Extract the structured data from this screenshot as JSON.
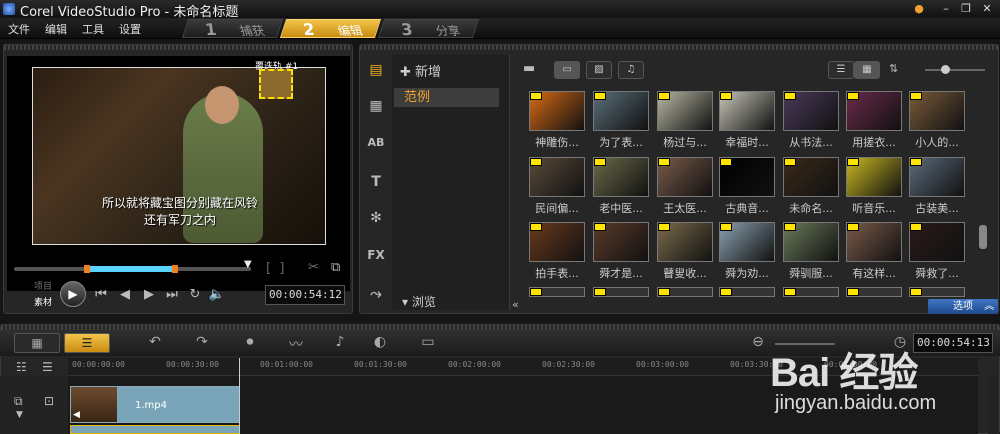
{
  "window": {
    "title": "Corel VideoStudio Pro - 未命名标题"
  },
  "menu": [
    "文件",
    "编辑",
    "工具",
    "设置"
  ],
  "steps": [
    {
      "num": "1",
      "label": "捕获"
    },
    {
      "num": "2",
      "label": "编辑"
    },
    {
      "num": "3",
      "label": "分享"
    }
  ],
  "preview": {
    "overlay_track_label": "覆迭轨 #1",
    "subtitle_line1": "所以就将藏宝图分别藏在风铃",
    "subtitle_line2": "还有军刀之内",
    "project_label": "项目",
    "clip_label": "素材",
    "timecode": "00:00:54:12",
    "scrub_selection_start": 0.31,
    "scrub_selection_end": 0.68
  },
  "library": {
    "add_label": "新增",
    "selected_folder": "范例",
    "browse_label": "浏览",
    "options_label": "选项",
    "thumbs": [
      [
        "神雕伤...",
        "为了表...",
        "杨过与...",
        "幸福时...",
        "从书法...",
        "用搓衣...",
        "小人的..."
      ],
      [
        "民间偏...",
        "老中医...",
        "王太医...",
        "古典音...",
        "未命名...",
        "听音乐...",
        "古装美..."
      ],
      [
        "拍手表...",
        "舜才是...",
        "瞽叟收...",
        "舜为劝...",
        "舜驯服...",
        "有这样...",
        "舜救了..."
      ]
    ],
    "thumb_colors": [
      [
        "#d86a14",
        "#5a6e7a",
        "#b9b8a5",
        "#c8c6b8",
        "#4a3a5a",
        "#6a2a4a",
        "#7a5a3a"
      ],
      [
        "#5a4a3a",
        "#6a6a4a",
        "#7a5a4a",
        "#000000",
        "#3a2a1a",
        "#c8b820",
        "#5a6a7a"
      ],
      [
        "#6a3a1a",
        "#5a3a2a",
        "#7a6a4a",
        "#8aa0b0",
        "#6a7a5a",
        "#7a5a4a",
        "#2a1a1a"
      ]
    ]
  },
  "timeline": {
    "timecode": "00:00:54:13",
    "ruler": [
      "00:00:00:00",
      "00:00:30:00",
      "00:01:00:00",
      "00:01:30:00",
      "00:02:00:00",
      "00:02:30:00",
      "00:03:00:00",
      "00:03:30:00",
      "00:04:00:00"
    ],
    "clip_name": "1.mp4"
  },
  "watermark": {
    "brand": "Bai 经验",
    "url": "jingyan.baidu.com"
  },
  "colors": {
    "accent": "#f0b020",
    "selection": "#5ad3ff",
    "clip": "#7aa5b8"
  }
}
